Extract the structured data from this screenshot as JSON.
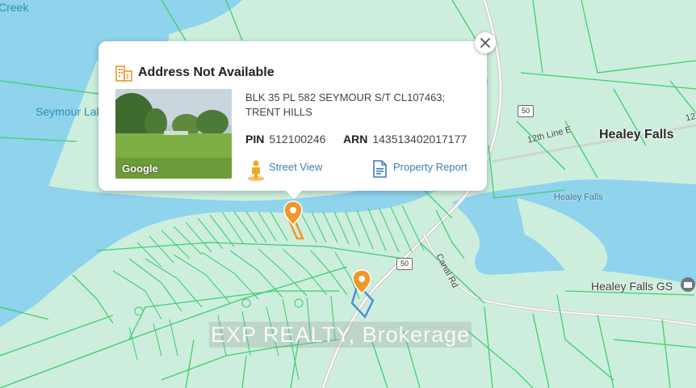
{
  "map": {
    "labels": {
      "creek": "Creek",
      "seymour_lake": "Seymour Lak",
      "healey_falls": "Healey Falls",
      "healey_falls_water": "Healey Falls",
      "healey_falls_gs": "Healey Falls GS",
      "road_12th_line": "12th Line E",
      "canal_rd": "Canal Rd",
      "edge_number": "12"
    },
    "road_shields": [
      "50",
      "50"
    ],
    "watermark": "EXP REALTY, Brokerage",
    "colors": {
      "water": "#8fd3ec",
      "land": "#cdeedd",
      "parcel_lines": "#3fcf6f",
      "road": "#d2d2d2",
      "pin_orange": "#f0962a",
      "selected_parcel_blue": "#4a8fd8"
    }
  },
  "popup": {
    "title": "Address Not Available",
    "title_icon": "building-icon",
    "photo_logo": "Google",
    "legal_description": "BLK 35 PL 582 SEYMOUR S/T CL107463; TRENT HILLS",
    "pin_label": "PIN",
    "pin_value": "512100246",
    "arn_label": "ARN",
    "arn_value": "143513402017177",
    "street_view_label": "Street View",
    "street_view_icon": "pegman-icon",
    "property_report_label": "Property Report",
    "property_report_icon": "report-icon",
    "close_icon": "close-icon"
  }
}
